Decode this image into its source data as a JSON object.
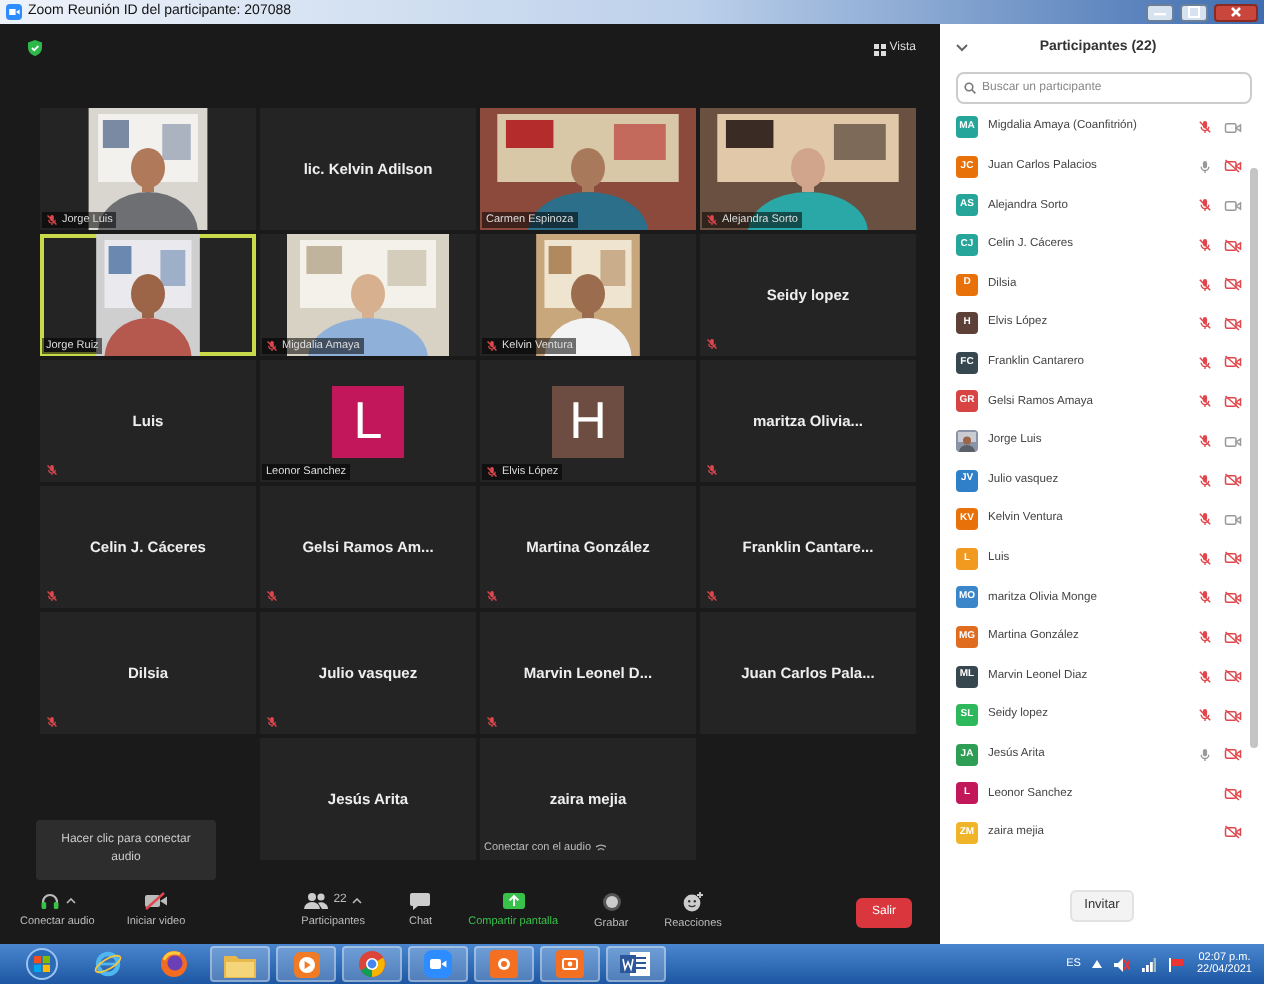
{
  "window": {
    "title": "Zoom Reunión ID del participante: 207088"
  },
  "meeting": {
    "view_label": "Vista"
  },
  "tiles": [
    {
      "kind": "video",
      "name": "Jorge Luis",
      "muted": true,
      "speaking": false
    },
    {
      "kind": "name",
      "name": "lic. Kelvin Adilson",
      "muted": false,
      "speaking": false
    },
    {
      "kind": "video",
      "name": "Carmen Espinoza",
      "muted": false,
      "speaking": false
    },
    {
      "kind": "video",
      "name": "Alejandra Sorto",
      "muted": true,
      "speaking": false
    },
    {
      "kind": "video",
      "name": "Jorge Ruiz",
      "muted": false,
      "speaking": true
    },
    {
      "kind": "video",
      "name": "Migdalia Amaya",
      "muted": true,
      "speaking": false
    },
    {
      "kind": "video",
      "name": "Kelvin Ventura",
      "muted": true,
      "speaking": false
    },
    {
      "kind": "name",
      "name": "Seidy lopez",
      "muted": true,
      "speaking": false
    },
    {
      "kind": "name",
      "name": "Luis",
      "muted": true,
      "speaking": false
    },
    {
      "kind": "avatar",
      "letter": "L",
      "color": "#c2185b",
      "name": "Leonor Sanchez",
      "muted": false,
      "speaking": false
    },
    {
      "kind": "avatar",
      "letter": "H",
      "color": "#6d4c41",
      "name": "Elvis López",
      "muted": true,
      "speaking": false
    },
    {
      "kind": "name",
      "name": "maritza  Olivia...",
      "muted": true,
      "speaking": false
    },
    {
      "kind": "name",
      "name": "Celin J. Cáceres",
      "muted": true,
      "speaking": false
    },
    {
      "kind": "name",
      "name": "Gelsi Ramos Am...",
      "muted": true,
      "speaking": false
    },
    {
      "kind": "name",
      "name": "Martina González",
      "muted": true,
      "speaking": false
    },
    {
      "kind": "name",
      "name": "Franklin  Cantare...",
      "muted": true,
      "speaking": false
    },
    {
      "kind": "name",
      "name": "Dilsia",
      "muted": true,
      "speaking": false
    },
    {
      "kind": "name",
      "name": "Julio vasquez",
      "muted": true,
      "speaking": false
    },
    {
      "kind": "name",
      "name": "Marvin  Leonel D...",
      "muted": true,
      "speaking": false
    },
    {
      "kind": "name",
      "name": "Juan Carlos  Pala...",
      "muted": false,
      "speaking": false
    },
    {
      "kind": "empty"
    },
    {
      "kind": "name",
      "name": "Jesús Arita",
      "muted": false,
      "speaking": false
    },
    {
      "kind": "name",
      "name": "zaira mejia",
      "muted": false,
      "speaking": false,
      "status": "Conectar con el audio"
    },
    {
      "kind": "empty"
    }
  ],
  "tooltip": "Hacer clic para conectar audio",
  "toolbar": {
    "items": [
      {
        "kind": "headphones",
        "label": "Conectar audio",
        "menu": true,
        "highlight": false
      },
      {
        "kind": "video-off",
        "label": "Iniciar video",
        "menu": false,
        "highlight": false
      },
      {
        "kind": "people",
        "label": "Participantes",
        "count": "22",
        "menu": true,
        "highlight": false
      },
      {
        "kind": "chat",
        "label": "Chat",
        "menu": false,
        "highlight": false
      },
      {
        "kind": "share",
        "label": "Compartir pantalla",
        "menu": false,
        "highlight": true
      },
      {
        "kind": "record",
        "label": "Grabar",
        "menu": false,
        "highlight": false
      },
      {
        "kind": "reactions",
        "label": "Reacciones",
        "menu": false,
        "highlight": false
      }
    ],
    "leave": "Salir"
  },
  "panel": {
    "title": "Participantes (22)",
    "search": {
      "placeholder": "Buscar un participante"
    },
    "invite": "Invitar"
  },
  "participants": [
    {
      "kind": "initials",
      "initials": "MA",
      "color": "#26a69a",
      "name": "Migdalia Amaya (Coanfitrión)",
      "audio_connected": true,
      "muted": true,
      "video_on": true
    },
    {
      "kind": "initials",
      "initials": "JC",
      "color": "#e8710a",
      "name": "Juan Carlos Palacios",
      "audio_connected": true,
      "muted": false,
      "video_on": false
    },
    {
      "kind": "initials",
      "initials": "AS",
      "color": "#26a69a",
      "name": "Alejandra Sorto",
      "audio_connected": true,
      "muted": true,
      "video_on": true
    },
    {
      "kind": "initials",
      "initials": "CJ",
      "color": "#26a69a",
      "name": "Celin J. Cáceres",
      "audio_connected": true,
      "muted": true,
      "video_on": false
    },
    {
      "kind": "initials",
      "initials": "D",
      "color": "#e8710a",
      "name": "Dilsia",
      "audio_connected": true,
      "muted": true,
      "video_on": false
    },
    {
      "kind": "initials",
      "initials": "H",
      "color": "#5d4037",
      "name": "Elvis López",
      "audio_connected": true,
      "muted": true,
      "video_on": false
    },
    {
      "kind": "initials",
      "initials": "FC",
      "color": "#37474f",
      "name": "Franklin Cantarero",
      "audio_connected": true,
      "muted": true,
      "video_on": false
    },
    {
      "kind": "initials",
      "initials": "GR",
      "color": "#d84343",
      "name": "Gelsi Ramos Amaya",
      "audio_connected": true,
      "muted": true,
      "video_on": false
    },
    {
      "kind": "picture",
      "name": "Jorge Luis",
      "audio_connected": true,
      "muted": true,
      "video_on": true
    },
    {
      "kind": "initials",
      "initials": "JV",
      "color": "#2f80c9",
      "name": "Julio vasquez",
      "audio_connected": true,
      "muted": true,
      "video_on": false
    },
    {
      "kind": "initials",
      "initials": "KV",
      "color": "#e8710a",
      "name": "Kelvin Ventura",
      "audio_connected": true,
      "muted": true,
      "video_on": true
    },
    {
      "kind": "initials",
      "initials": "L",
      "color": "#f29a1f",
      "name": "Luis",
      "audio_connected": true,
      "muted": true,
      "video_on": false
    },
    {
      "kind": "initials",
      "initials": "MO",
      "color": "#3a86c8",
      "name": "maritza Olivia Monge",
      "audio_connected": true,
      "muted": true,
      "video_on": false
    },
    {
      "kind": "initials",
      "initials": "MG",
      "color": "#e06c1f",
      "name": "Martina González",
      "audio_connected": true,
      "muted": true,
      "video_on": false
    },
    {
      "kind": "initials",
      "initials": "ML",
      "color": "#37474f",
      "name": "Marvin Leonel Diaz",
      "audio_connected": true,
      "muted": true,
      "video_on": false
    },
    {
      "kind": "initials",
      "initials": "SL",
      "color": "#2eb85c",
      "name": "Seidy lopez",
      "audio_connected": true,
      "muted": true,
      "video_on": false
    },
    {
      "kind": "initials",
      "initials": "JA",
      "color": "#2e9e55",
      "name": "Jesús Arita",
      "audio_connected": true,
      "muted": false,
      "video_on": false
    },
    {
      "kind": "initials",
      "initials": "L",
      "color": "#c2185b",
      "name": "Leonor Sanchez",
      "audio_connected": false,
      "video_on": false
    },
    {
      "kind": "initials",
      "initials": "ZM",
      "color": "#f0b429",
      "name": "zaira mejia",
      "audio_connected": false,
      "video_on": false
    }
  ],
  "taskbar": {
    "apps": [
      {
        "kind": "start",
        "running": false
      },
      {
        "kind": "ie",
        "running": false
      },
      {
        "kind": "firefox",
        "running": false
      },
      {
        "kind": "folder",
        "running": true
      },
      {
        "kind": "media",
        "running": true
      },
      {
        "kind": "chrome",
        "running": true
      },
      {
        "kind": "zoom",
        "running": true
      },
      {
        "kind": "orange",
        "running": true
      },
      {
        "kind": "orange2",
        "running": true
      },
      {
        "kind": "word",
        "running": true
      }
    ],
    "language": "ES",
    "time": "02:07 p.m.",
    "date": "22/04/2021"
  }
}
